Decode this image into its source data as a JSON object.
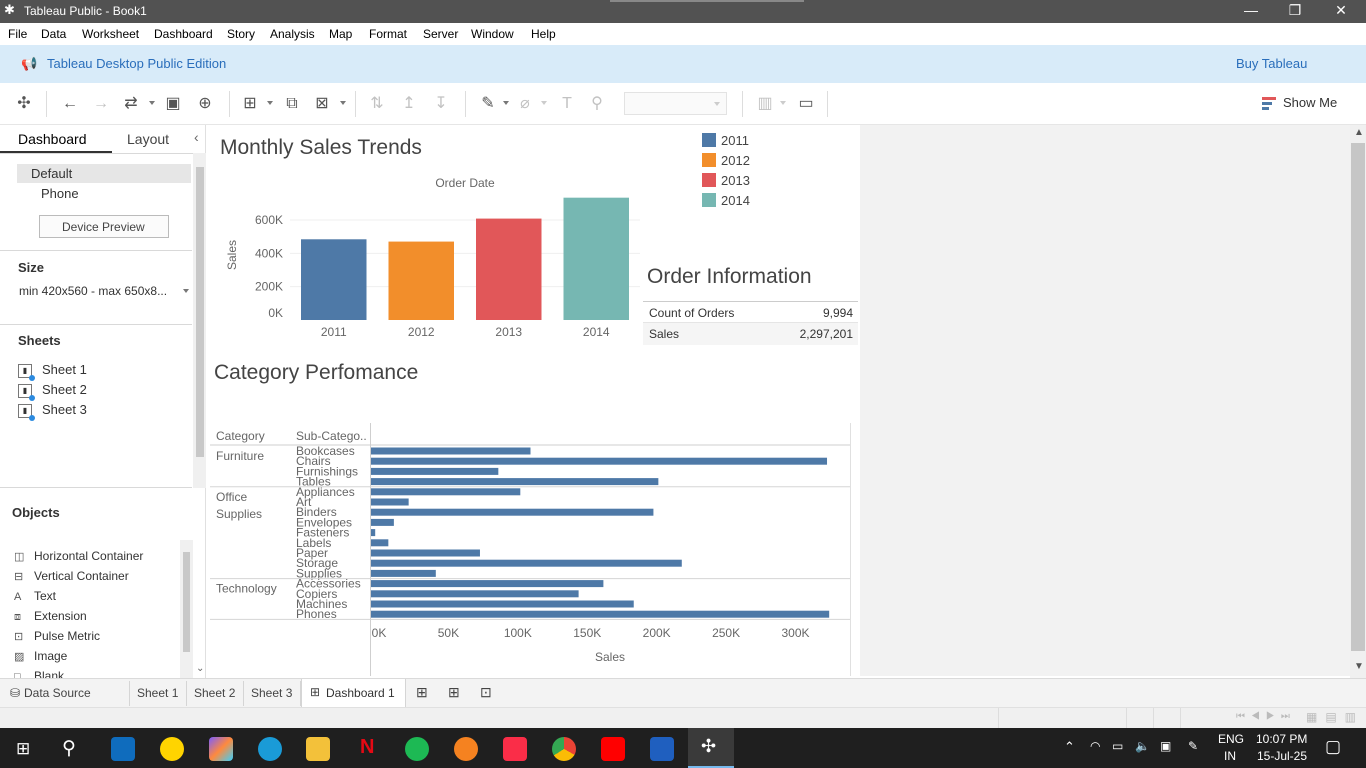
{
  "window": {
    "title": "Tableau Public - Book1",
    "minimize": "—",
    "maximize": "❐",
    "close": "✕"
  },
  "menu": [
    "File",
    "Data",
    "Worksheet",
    "Dashboard",
    "Story",
    "Analysis",
    "Map",
    "Format",
    "Server",
    "Window",
    "Help"
  ],
  "banner": {
    "edition": "Tableau Desktop Public Edition",
    "buy": "Buy Tableau"
  },
  "toolbar": {
    "show_me": "Show Me"
  },
  "left_pane": {
    "tab_dashboard": "Dashboard",
    "tab_layout": "Layout",
    "device_default": "Default",
    "device_phone": "Phone",
    "device_preview": "Device Preview",
    "size_title": "Size",
    "size_value": "min 420x560 - max 650x8...",
    "sheets_title": "Sheets",
    "sheets": [
      "Sheet 1",
      "Sheet 2",
      "Sheet 3"
    ],
    "objects_title": "Objects",
    "objects": [
      {
        "label": "Horizontal Container",
        "icon": "horizontal-container-icon"
      },
      {
        "label": "Vertical Container",
        "icon": "vertical-container-icon"
      },
      {
        "label": "Text",
        "icon": "text-icon"
      },
      {
        "label": "Extension",
        "icon": "extension-icon"
      },
      {
        "label": "Pulse Metric",
        "icon": "pulse-metric-icon"
      },
      {
        "label": "Image",
        "icon": "image-icon"
      },
      {
        "label": "Blank",
        "icon": "blank-icon"
      }
    ]
  },
  "dashboard": {
    "monthly_title": "Monthly Sales Trends",
    "order_info_title": "Order Information",
    "category_title": "Category Perfomance",
    "order_info": [
      {
        "label": "Count of Orders",
        "value": "9,994"
      },
      {
        "label": "Sales",
        "value": "2,297,201"
      }
    ],
    "legend": [
      {
        "label": "2011",
        "color": "#4e79a7"
      },
      {
        "label": "2012",
        "color": "#f28e2b"
      },
      {
        "label": "2013",
        "color": "#e15759"
      },
      {
        "label": "2014",
        "color": "#76b7b2"
      }
    ]
  },
  "chart_data": [
    {
      "type": "bar",
      "title": "Order Date",
      "xlabel": "",
      "ylabel": "Sales",
      "categories": [
        "2011",
        "2012",
        "2013",
        "2014"
      ],
      "values": [
        484247,
        470533,
        608473,
        733947
      ],
      "colors": [
        "#4e79a7",
        "#f28e2b",
        "#e15759",
        "#76b7b2"
      ],
      "y_ticks": [
        "0K",
        "200K",
        "400K",
        "600K"
      ],
      "ylim": [
        0,
        780000
      ]
    },
    {
      "type": "bar",
      "orientation": "horizontal",
      "xlabel": "Sales",
      "headers": {
        "category": "Category",
        "subcategory": "Sub-Catego.."
      },
      "x_ticks": [
        "0K",
        "50K",
        "100K",
        "150K",
        "200K",
        "250K",
        "300K"
      ],
      "xlim": [
        0,
        345000
      ],
      "color": "#4e79a7",
      "groups": [
        {
          "category": "Furniture",
          "items": [
            {
              "name": "Bookcases",
              "value": 114880
            },
            {
              "name": "Chairs",
              "value": 328449
            },
            {
              "name": "Furnishings",
              "value": 91705
            },
            {
              "name": "Tables",
              "value": 206966
            }
          ]
        },
        {
          "category": "Office Supplies",
          "items": [
            {
              "name": "Appliances",
              "value": 107532
            },
            {
              "name": "Art",
              "value": 27119
            },
            {
              "name": "Binders",
              "value": 203413
            },
            {
              "name": "Envelopes",
              "value": 16476
            },
            {
              "name": "Fasteners",
              "value": 3024
            },
            {
              "name": "Labels",
              "value": 12486
            },
            {
              "name": "Paper",
              "value": 78479
            },
            {
              "name": "Storage",
              "value": 223844
            },
            {
              "name": "Supplies",
              "value": 46674
            }
          ]
        },
        {
          "category": "Technology",
          "items": [
            {
              "name": "Accessories",
              "value": 167380
            },
            {
              "name": "Copiers",
              "value": 149528
            },
            {
              "name": "Machines",
              "value": 189239
            },
            {
              "name": "Phones",
              "value": 330007
            }
          ]
        }
      ]
    }
  ],
  "bottom_tabs": {
    "data_source": "Data Source",
    "sheets": [
      "Sheet 1",
      "Sheet 2",
      "Sheet 3"
    ],
    "dashboard": "Dashboard 1"
  },
  "taskbar": {
    "lang1": "ENG",
    "lang2": "IN",
    "time": "10:07 PM",
    "date": "15-Jul-25"
  }
}
